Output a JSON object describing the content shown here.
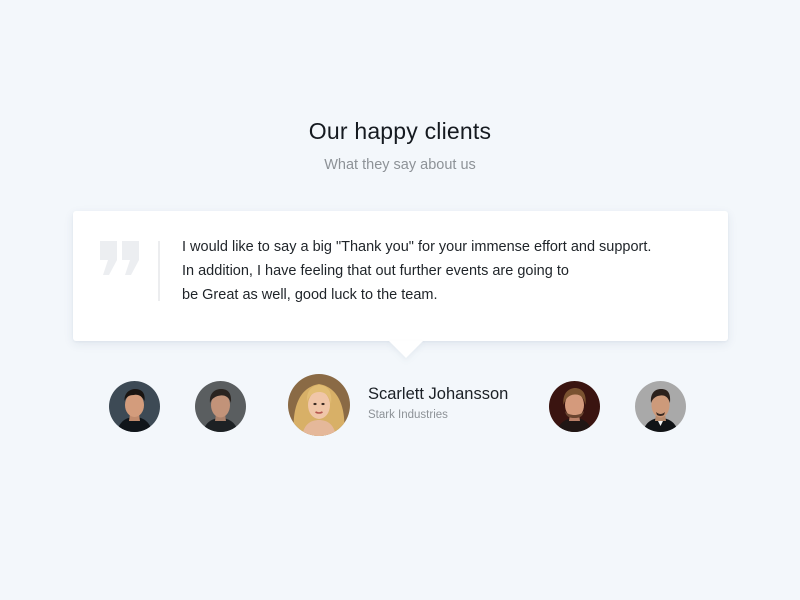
{
  "header": {
    "title": "Our happy clients",
    "subtitle": "What they say about us"
  },
  "testimonial": {
    "icon": "quote-icon",
    "lines": [
      "I would like to say a big \"Thank you\" for your immense effort and support.",
      "In addition, I have feeling that out further events are going to",
      "be Great as well, good luck to the team."
    ]
  },
  "active_client": {
    "name": "Scarlett Johansson",
    "company": "Stark Industries"
  },
  "colors": {
    "background": "#f3f7fb",
    "card": "#ffffff",
    "title": "#151a20",
    "muted": "#8d9297",
    "quote_mark": "#eceef1"
  }
}
